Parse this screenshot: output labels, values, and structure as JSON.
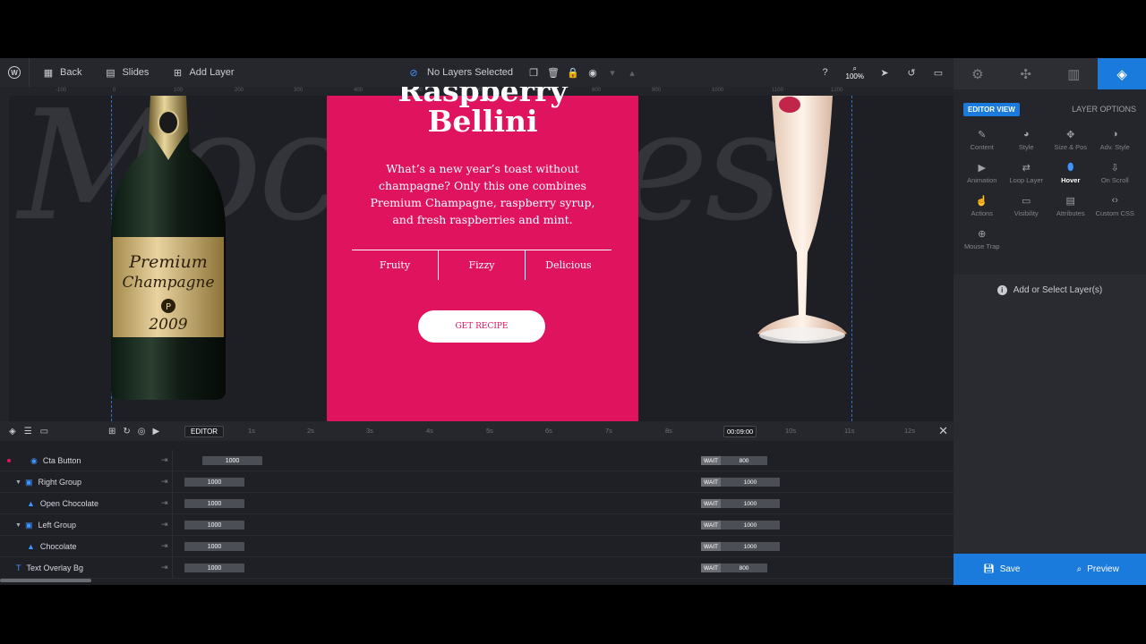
{
  "toolbar": {
    "back_label": "Back",
    "slides_label": "Slides",
    "add_layer_label": "Add Layer",
    "selection_status": "No Layers Selected",
    "zoom": "100%"
  },
  "slide": {
    "title_line1": "Raspberry",
    "title_line2": "Bellini",
    "description": "What’s a new year’s toast without champagne? Only this one combines Premium Champagne, raspberry syrup, and fresh raspberries and mint.",
    "tags": [
      "Fruity",
      "Fizzy",
      "Delicious"
    ],
    "cta": "GET RECIPE",
    "bottle_line1": "Premium",
    "bottle_line2": "Champagne",
    "bottle_year": "2009",
    "bottle_badge": "P"
  },
  "rulers": {
    "h": [
      "-100",
      "0",
      "100",
      "200",
      "300",
      "400",
      "500",
      "600",
      "700",
      "800",
      "900",
      "1000",
      "1100",
      "1200"
    ]
  },
  "panel": {
    "editor_view": "EDITOR VIEW",
    "layer_options": "LAYER OPTIONS",
    "options": [
      {
        "label": "Content",
        "icon": "pencil-icon"
      },
      {
        "label": "Style",
        "icon": "palette-icon"
      },
      {
        "label": "Size & Pos",
        "icon": "move-icon"
      },
      {
        "label": "Adv. Style",
        "icon": "contrast-icon"
      },
      {
        "label": "Animation",
        "icon": "play-icon"
      },
      {
        "label": "Loop Layer",
        "icon": "loop-icon"
      },
      {
        "label": "Hover",
        "icon": "mouse-icon"
      },
      {
        "label": "On Scroll",
        "icon": "scroll-icon"
      },
      {
        "label": "Actions",
        "icon": "hand-icon"
      },
      {
        "label": "Visibility",
        "icon": "monitor-icon"
      },
      {
        "label": "Attributes",
        "icon": "file-icon"
      },
      {
        "label": "Custom CSS",
        "icon": "code-icon"
      },
      {
        "label": "Mouse Trap",
        "icon": "crosshair-icon"
      }
    ],
    "active_option": "Hover",
    "empty_message": "Add or Select Layer(s)",
    "save_label": "Save",
    "preview_label": "Preview"
  },
  "timeline": {
    "editor_chip": "EDITOR",
    "ticks": [
      "1s",
      "2s",
      "3s",
      "4s",
      "5s",
      "6s",
      "7s",
      "8s",
      "10s",
      "11s",
      "12s"
    ],
    "current_time": "00:09:00",
    "wait_label": "WAIT",
    "layers": [
      {
        "name": "Cta Button",
        "type": "button",
        "start": "1000",
        "end": "800"
      },
      {
        "name": "Right Group",
        "type": "group",
        "start": "1000",
        "end": "1000"
      },
      {
        "name": "Open Chocolate",
        "type": "image",
        "start": "1000",
        "end": "1000"
      },
      {
        "name": "Left Group",
        "type": "group",
        "start": "1000",
        "end": "1000"
      },
      {
        "name": "Chocolate",
        "type": "image",
        "start": "1000",
        "end": "1000"
      },
      {
        "name": "Text Overlay Bg",
        "type": "text",
        "start": "1000",
        "end": "800"
      }
    ]
  },
  "colors": {
    "accent": "#1b7bdc",
    "slide_bg": "#e0135f",
    "panel_bg": "#25262b"
  }
}
